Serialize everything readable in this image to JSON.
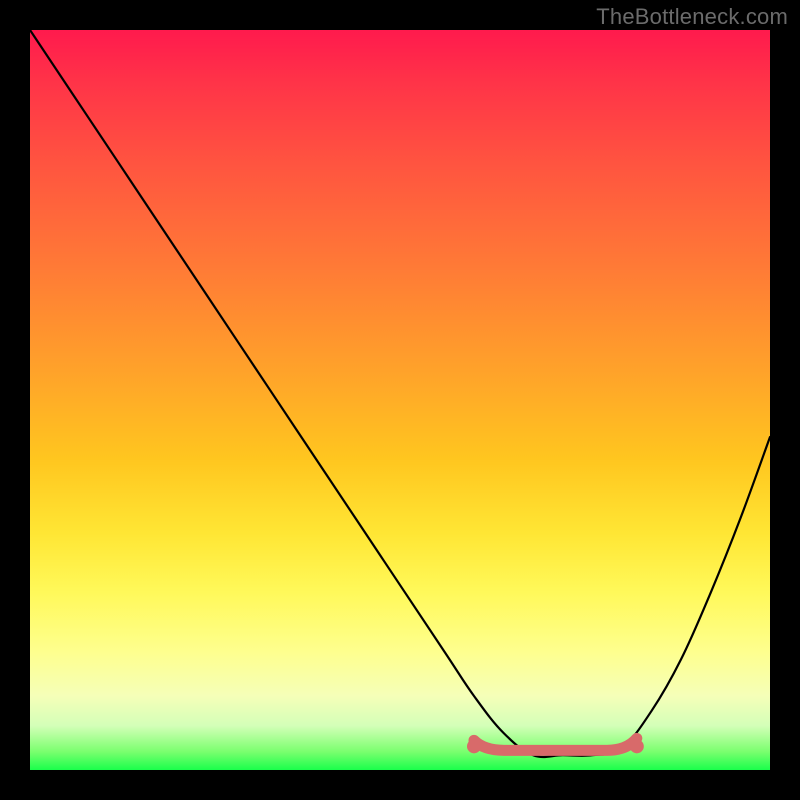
{
  "watermark": "TheBottleneck.com",
  "chart_data": {
    "type": "line",
    "title": "",
    "xlabel": "",
    "ylabel": "",
    "xlim": [
      0,
      100
    ],
    "ylim": [
      0,
      100
    ],
    "series": [
      {
        "name": "bottleneck-curve",
        "x": [
          0,
          8,
          16,
          24,
          32,
          40,
          48,
          56,
          60,
          64,
          68,
          72,
          76,
          80,
          84,
          88,
          92,
          96,
          100
        ],
        "values": [
          100,
          88,
          76,
          64,
          52,
          40,
          28,
          16,
          10,
          5,
          2,
          2,
          2,
          3,
          8,
          15,
          24,
          34,
          45
        ]
      }
    ],
    "highlight_band": {
      "x_start": 60,
      "x_end": 82,
      "y": 3.2
    },
    "gradient_stops": [
      {
        "pct": 0,
        "color": "#ff1a4d"
      },
      {
        "pct": 7,
        "color": "#ff3348"
      },
      {
        "pct": 18,
        "color": "#ff5440"
      },
      {
        "pct": 32,
        "color": "#ff7a36"
      },
      {
        "pct": 46,
        "color": "#ffa22a"
      },
      {
        "pct": 58,
        "color": "#ffc61f"
      },
      {
        "pct": 68,
        "color": "#ffe634"
      },
      {
        "pct": 76,
        "color": "#fff95a"
      },
      {
        "pct": 84,
        "color": "#feff8e"
      },
      {
        "pct": 90,
        "color": "#f5ffb8"
      },
      {
        "pct": 94,
        "color": "#d4ffb8"
      },
      {
        "pct": 97.5,
        "color": "#7bff6f"
      },
      {
        "pct": 100,
        "color": "#1aff4b"
      }
    ],
    "colors": {
      "curve": "#000000",
      "highlight": "#d86a6a",
      "frame_bg": "#000000"
    }
  }
}
